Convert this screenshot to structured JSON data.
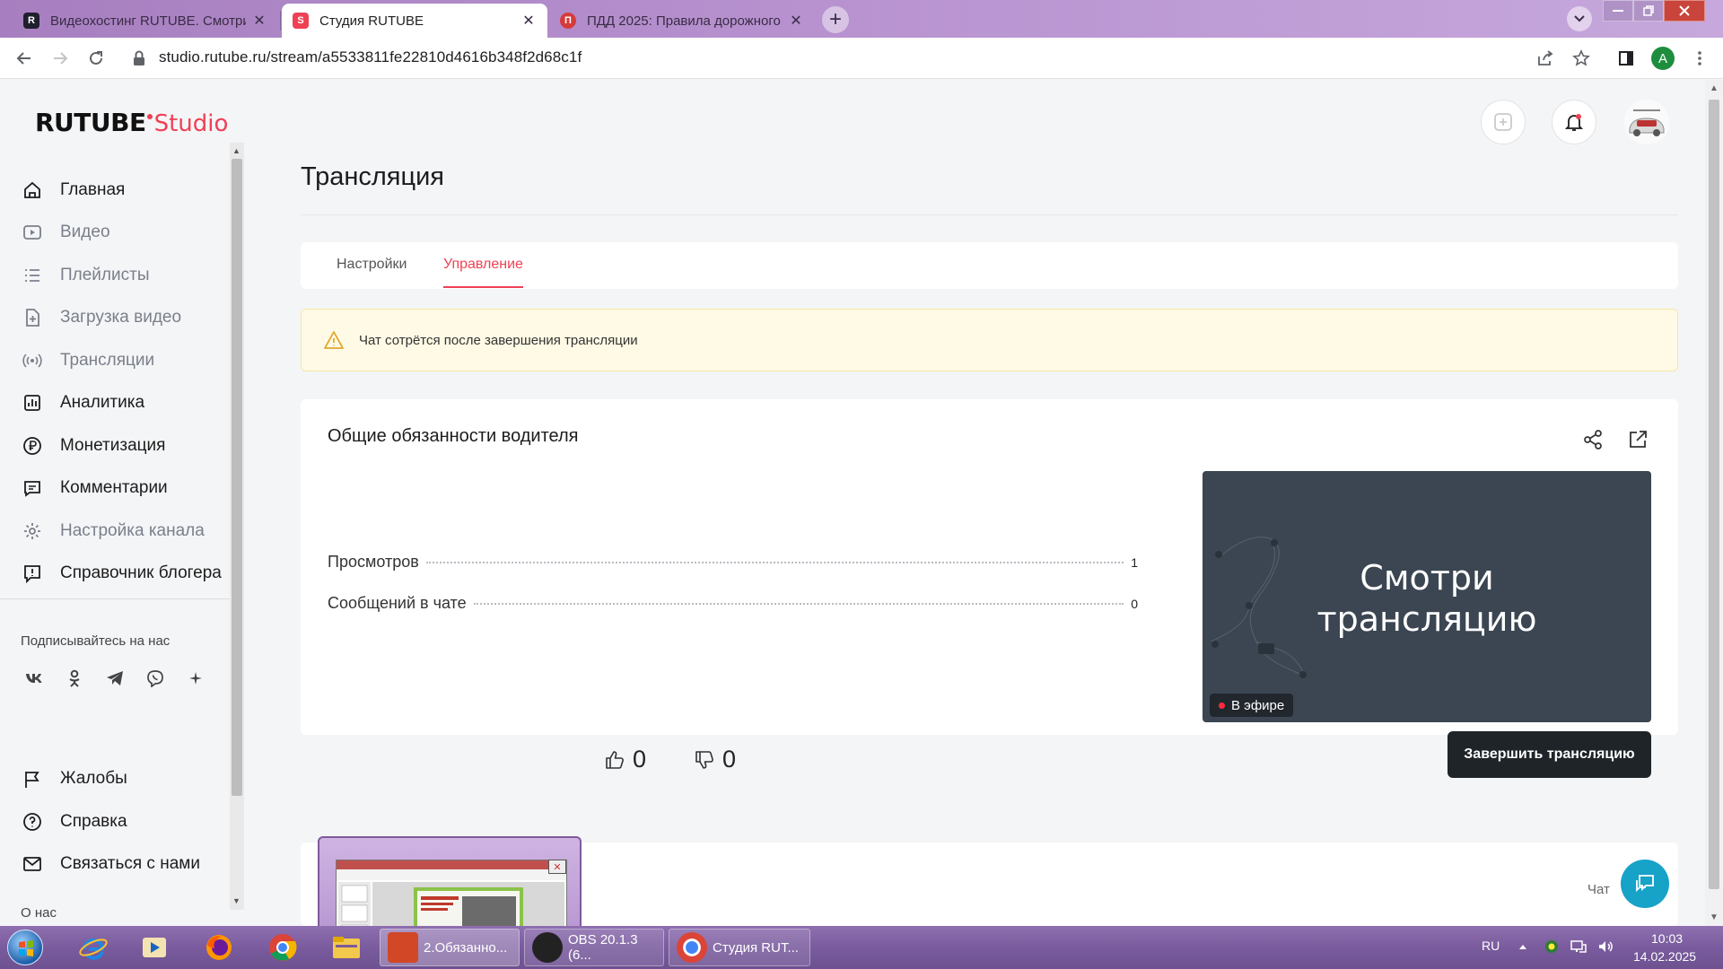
{
  "browser": {
    "tabs": [
      {
        "title": "Видеохостинг RUTUBE. Смотрит",
        "icon": "rutube-favicon",
        "active": false
      },
      {
        "title": "Студия RUTUBE",
        "icon": "rutube-studio-favicon",
        "active": true
      },
      {
        "title": "ПДД 2025: Правила дорожного",
        "icon": "pdd-favicon",
        "active": false
      }
    ],
    "close_glyph": "✕",
    "new_tab_glyph": "+",
    "url": "studio.rutube.ru/stream/a5533811fe22810d4616b348f2d68c1f",
    "profile_initial": "A"
  },
  "sidebar": {
    "logo_main": "RUTUBE",
    "logo_studio": "Studio",
    "items": [
      {
        "label": "Главная",
        "icon": "home-icon",
        "muted": false
      },
      {
        "label": "Видео",
        "icon": "video-icon",
        "muted": true
      },
      {
        "label": "Плейлисты",
        "icon": "playlist-icon",
        "muted": true
      },
      {
        "label": "Загрузка видео",
        "icon": "upload-icon",
        "muted": true
      },
      {
        "label": "Трансляции",
        "icon": "broadcast-icon",
        "muted": true
      },
      {
        "label": "Аналитика",
        "icon": "analytics-icon",
        "muted": false
      },
      {
        "label": "Монетизация",
        "icon": "ruble-icon",
        "muted": false
      },
      {
        "label": "Комментарии",
        "icon": "comment-icon",
        "muted": false
      },
      {
        "label": "Настройка канала",
        "icon": "gear-icon",
        "muted": true
      },
      {
        "label": "Справочник блогера",
        "icon": "info-icon",
        "muted": false
      }
    ],
    "follow_label": "Подписывайтесь на нас",
    "socials": [
      "vk-icon",
      "ok-icon",
      "telegram-icon",
      "viber-icon",
      "sparkle-icon"
    ],
    "bottom_items": [
      {
        "label": "Жалобы",
        "icon": "flag-icon"
      },
      {
        "label": "Справка",
        "icon": "help-icon"
      },
      {
        "label": "Связаться с нами",
        "icon": "mail-icon"
      }
    ],
    "about_label": "О нас"
  },
  "main": {
    "page_title": "Трансляция",
    "tabs": [
      {
        "label": "Настройки",
        "active": false
      },
      {
        "label": "Управление",
        "active": true
      }
    ],
    "alert_text": "Чат сотрётся после завершения трансляции",
    "stream": {
      "title": "Общие обязанности водителя",
      "stats": [
        {
          "label": "Просмотров",
          "value": "1"
        },
        {
          "label": "Сообщений в чате",
          "value": "0"
        }
      ],
      "preview_line1": "Смотри",
      "preview_line2": "трансляцию",
      "live_label": "В эфире",
      "likes": "0",
      "dislikes": "0",
      "end_button": "Завершить трансляцию"
    },
    "chat_label": "Чат"
  },
  "taskbar": {
    "tasks": [
      {
        "label": "2.Обязанно...",
        "icon": "powerpoint-icon"
      },
      {
        "label": "OBS 20.1.3 (6...",
        "icon": "obs-icon"
      },
      {
        "label": "Студия RUT...",
        "icon": "chrome-icon"
      }
    ],
    "lang": "RU",
    "time": "10:03",
    "date": "14.02.2025"
  },
  "colors": {
    "accent": "#ee4155",
    "button_dark": "#1f2428",
    "alert_bg": "#fffae5",
    "preview_bg": "#3b4652",
    "support_button": "#17a2c8"
  }
}
